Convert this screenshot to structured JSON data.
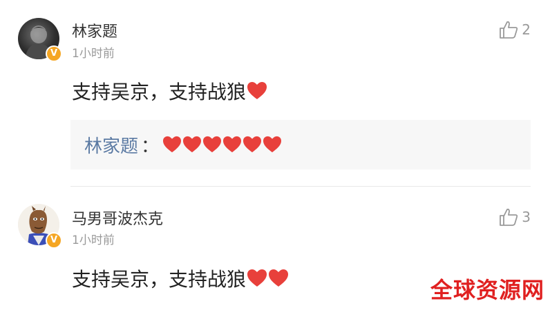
{
  "comments": [
    {
      "username": "林家题",
      "time": "1小时前",
      "likes": "2",
      "text": "支持吴京，支持战狼",
      "hearts": 1,
      "reply": {
        "name": "林家题",
        "colon": "：",
        "hearts": 6
      },
      "verified_badge": "V"
    },
    {
      "username": "马男哥波杰克",
      "time": "1小时前",
      "likes": "3",
      "text": "支持吴京，支持战狼",
      "hearts": 2,
      "verified_badge": "V"
    }
  ],
  "watermark": "全球资源网",
  "icons": {
    "like": "thumbs-up-icon",
    "heart": "red-heart-emoji",
    "badge": "verified-v-badge-icon"
  },
  "colors": {
    "heart": "#e8403b",
    "reply_name": "#5b7aa3",
    "badge": "#f5a623",
    "watermark": "#e02020"
  }
}
